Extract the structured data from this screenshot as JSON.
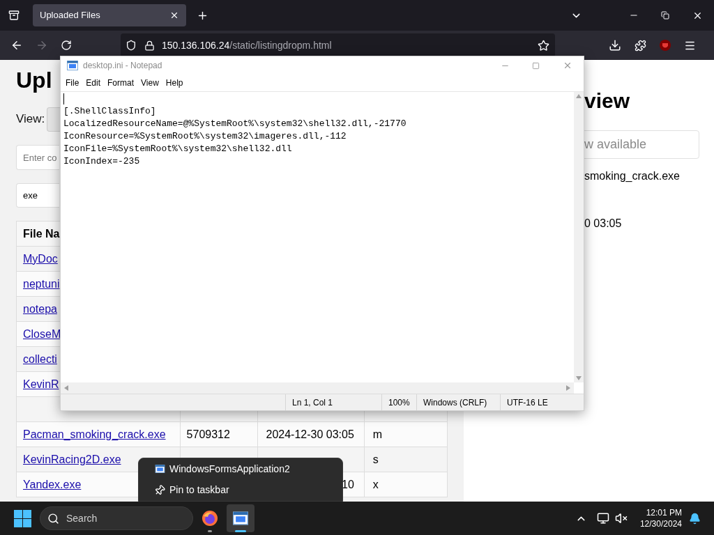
{
  "browser": {
    "tabs": [
      {
        "title": "Uploaded Files",
        "selected": true
      }
    ],
    "url": {
      "host": "150.136.106.24",
      "path": "/static/listingdropm.html"
    },
    "forward_disabled": true
  },
  "page": {
    "heading": "Upl",
    "view_label": "View:",
    "filter_placeholder": "Enter co",
    "search_value": "exe",
    "table": {
      "header": "File Na",
      "rows": [
        {
          "name": "MyDoc"
        },
        {
          "name": "neptuni"
        },
        {
          "name": "notepa"
        },
        {
          "name": "CloseM"
        },
        {
          "name": "collecti"
        },
        {
          "name": "KevinR"
        },
        {},
        {
          "name": "Pacman_smoking_crack.exe",
          "size": "5709312",
          "date": "2024-12-30 03:05",
          "col4": "m"
        },
        {
          "name": "KevinRacing2D.exe",
          "col4": "s"
        },
        {
          "name": "Yandex.exe",
          "date": "10",
          "col4": "x"
        }
      ]
    }
  },
  "preview": {
    "heading": "view",
    "box_text": "w available",
    "file_name": "smoking_crack.exe",
    "date": "0 03:05"
  },
  "notepad": {
    "title": "desktop.ini - Notepad",
    "menus": [
      "File",
      "Edit",
      "Format",
      "View",
      "Help"
    ],
    "lines": [
      "[.ShellClassInfo]",
      "LocalizedResourceName=@%SystemRoot%\\system32\\shell32.dll,-21770",
      "IconResource=%SystemRoot%\\system32\\imageres.dll,-112",
      "IconFile=%SystemRoot%\\system32\\shell32.dll",
      "IconIndex=-235"
    ],
    "status": [
      "Ln 1, Col 1",
      "100%",
      "Windows (CRLF)",
      "UTF-16 LE"
    ]
  },
  "context_menu": {
    "items": [
      {
        "label": "WindowsFormsApplication2",
        "kind": "app"
      },
      {
        "label": "Pin to taskbar",
        "kind": "pin"
      }
    ]
  },
  "taskbar": {
    "search": "Search",
    "apps": [
      {
        "kind": "firefox",
        "selected": false
      },
      {
        "kind": "app",
        "selected": true
      }
    ],
    "time": "12:01 PM",
    "date": "12/30/2024"
  }
}
